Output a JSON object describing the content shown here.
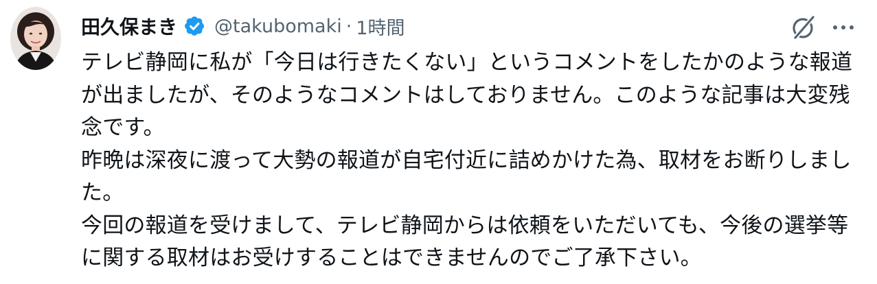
{
  "tweet": {
    "author": {
      "display_name": "田久保まき",
      "handle": "@takubomaki",
      "verified_icon": "verified-badge-icon",
      "verified_color": "#1d9bf0"
    },
    "separator": "·",
    "timestamp": "1時間",
    "actions": {
      "grok_icon": "grok-icon",
      "more_icon": "more-options-icon",
      "icon_color": "#536471"
    },
    "body": {
      "paragraphs": [
        "テレビ静岡に私が「今日は行きたくない」というコメントをしたかのような報道が出ましたが、そのようなコメントはしておりません。このような記事は大変残念です。",
        "昨晩は深夜に渡って大勢の報道が自宅付近に詰めかけた為、取材をお断りしました。",
        "今回の報道を受けまして、テレビ静岡からは依頼をいただいても、今後の選挙等に関する取材はお受けすることはできませんのでご了承下さい。"
      ]
    }
  }
}
